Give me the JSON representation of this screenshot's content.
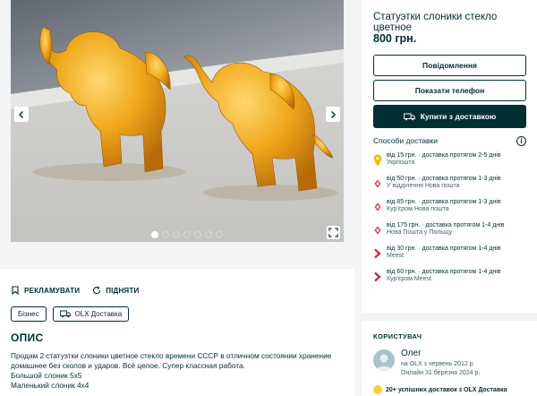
{
  "gallery": {
    "photo_alt": "Амберські скляні слоники",
    "slide_count": 7,
    "active_slide": 0
  },
  "actions": {
    "promote_label": "РЕКЛАМУВАТИ",
    "raise_label": "ПІДНЯТИ"
  },
  "tags": {
    "business": "Бізнес",
    "delivery": "OLX Доставка"
  },
  "description": {
    "heading": "ОПИС",
    "lines": [
      "Продам 2 статуэтки слоники цветное стекло времени СССР в отличном состоянии хранение",
      "домашнее без сколов и ударов. Всё целое. Супер классная работа.",
      "Большой слоник 5х5",
      "Маленький слоник 4х4"
    ]
  },
  "listing": {
    "title": "Статуэтки слоники стекло цветное",
    "price": "800 грн."
  },
  "buttons": {
    "message": "Повідомлення",
    "phone": "Показати телефон",
    "buy": "Купити з доставкою"
  },
  "delivery": {
    "heading": "Способи доставки",
    "info_glyph": "i",
    "options": [
      {
        "line1": "від 15 грн. · доставка протягом 2-5 днів",
        "line2": "Укрпошта",
        "icon": "ukrposhta-icon",
        "color": "#f5b800"
      },
      {
        "line1": "від 50 грн. · доставка протягом 1-3 днів",
        "line2": "У відділення Нова пошта",
        "icon": "nova-poshta-icon",
        "color": "#e0322e"
      },
      {
        "line1": "від 85 грн. · доставка протягом 1-3 днів",
        "line2": "Кур'єром Нова пошта",
        "icon": "nova-poshta-icon",
        "color": "#e0322e"
      },
      {
        "line1": "від 175 грн. · доставка протягом 1-4 днів",
        "line2": "Нова Пошта у Польщу",
        "icon": "nova-poshta-icon",
        "color": "#e0322e"
      },
      {
        "line1": "від 30 грн. · доставка протягом 1-4 днів",
        "line2": "Meest",
        "icon": "meest-icon",
        "color": "#d8232a"
      },
      {
        "line1": "від 60 грн. · доставка протягом 1-4 днів",
        "line2": "Кур'єром Meest",
        "icon": "meest-icon",
        "color": "#d8232a"
      }
    ]
  },
  "user": {
    "heading": "КОРИСТУВАЧ",
    "name": "Олег",
    "since": "на OLX з червень 2012 р.",
    "online": "Онлайн 31 березня 2024 р.",
    "badge": "20+ успішних доставок з OLX Доставка"
  },
  "colors": {
    "brand": "#002f34",
    "background": "#f2f4f5",
    "badge": "#ffce32"
  }
}
